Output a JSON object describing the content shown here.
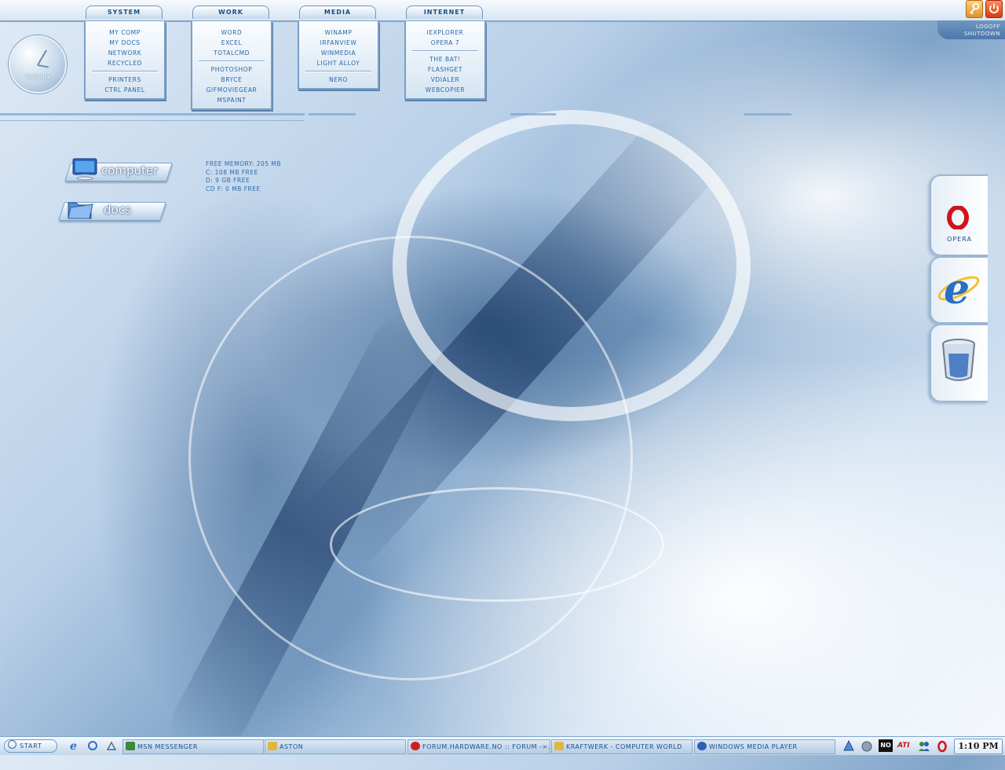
{
  "menus": [
    {
      "title": "SYSTEM",
      "items": [
        "MY COMP",
        "MY DOCS",
        "NETWORK",
        "RECYCLED",
        "---",
        "PRINTERS",
        "CTRL PANEL"
      ]
    },
    {
      "title": "WORK",
      "items": [
        "WORD",
        "EXCEL",
        "TOTALCMD",
        "---",
        "PHOTOSHOP",
        "BRYCE",
        "GIFMOVIEGEAR",
        "MSPAINT"
      ]
    },
    {
      "title": "MEDIA",
      "items": [
        "WINAMP",
        "IRFANVIEW",
        "WINMEDIA",
        "LIGHT ALLOY",
        "---",
        "NERO"
      ]
    },
    {
      "title": "INTERNET",
      "items": [
        "IEXPLORER",
        "OPERA 7",
        "---",
        "THE BAT!",
        "FLASHGET",
        "VDIALER",
        "WEBCOPIER"
      ]
    }
  ],
  "logoff": {
    "logoff_label": "LOGOFF",
    "shutdown_label": "SHUTDOWN"
  },
  "clock_widget": {
    "label": "insignia"
  },
  "desktop_icons": {
    "computer": "computer",
    "docs": "docs"
  },
  "stats": {
    "free_memory": "FREE MEMORY: 205 MB",
    "drive_c": "C: 108 MB FREE",
    "drive_d": "D: 9 GB FREE",
    "drive_f": "CD F: 0 MB FREE"
  },
  "dock": {
    "opera_label": "OPERA"
  },
  "taskbar": {
    "start_label": "START",
    "tasks": [
      {
        "label": "MSN MESSENGER",
        "icon": "msn-icon",
        "color": "#3c8a3c"
      },
      {
        "label": "ASTON",
        "icon": "folder-icon",
        "color": "#e0b640"
      },
      {
        "label": "FORUM.HARDWARE.NO :: FORUM ->...",
        "icon": "opera-icon",
        "color": "#cc2020"
      },
      {
        "label": "KRAFTWERK - COMPUTER WORLD",
        "icon": "folder-icon",
        "color": "#e0b640"
      },
      {
        "label": "WINDOWS MEDIA PLAYER",
        "icon": "media-player-icon",
        "color": "#2a62b8"
      }
    ],
    "tray_text": "NO",
    "tray_ati": "ATI",
    "clock": "1:10 PM"
  }
}
